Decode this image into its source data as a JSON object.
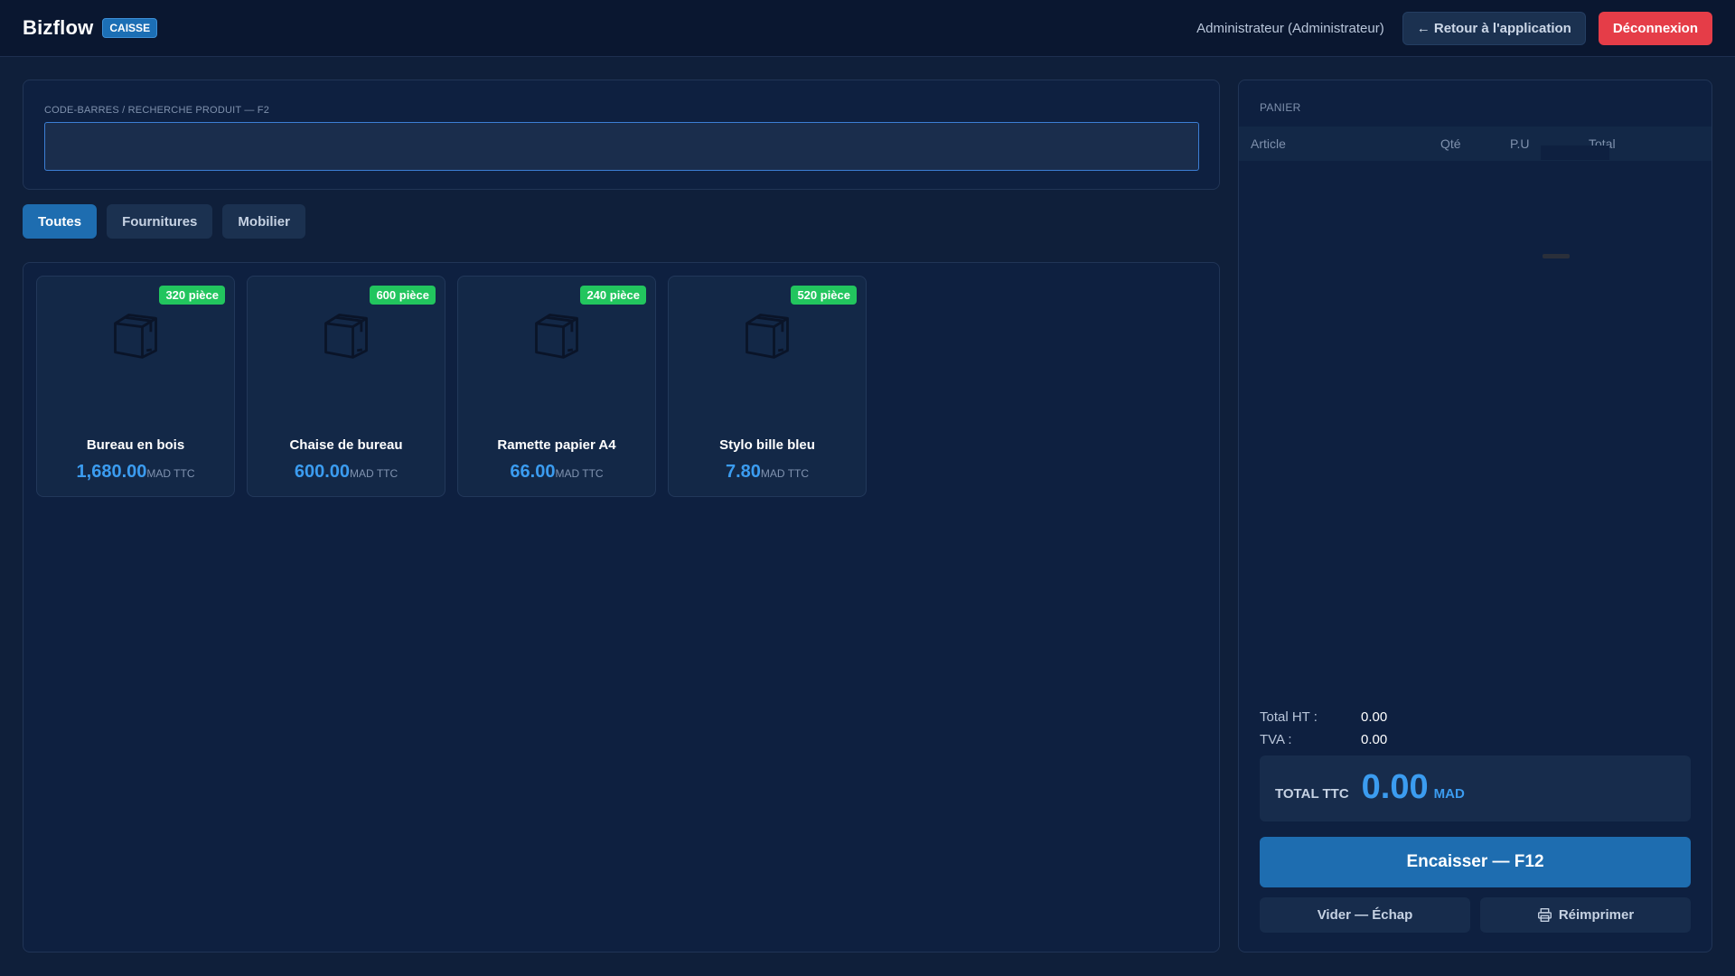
{
  "header": {
    "brand": "Bizflow",
    "badge": "CAISSE",
    "user": "Administrateur (Administrateur)",
    "back_button": "← Retour à l'application",
    "logout_button": "Déconnexion"
  },
  "search": {
    "label": "CODE-BARRES / RECHERCHE PRODUIT — F2",
    "value": "",
    "placeholder": ""
  },
  "tabs": [
    {
      "label": "Toutes",
      "active": true
    },
    {
      "label": "Fournitures",
      "active": false
    },
    {
      "label": "Mobilier",
      "active": false
    }
  ],
  "products": [
    {
      "name": "Bureau en bois",
      "price": "1,680.00",
      "unit": "MAD TTC",
      "stock": "320 pièce",
      "icon": "box-icon"
    },
    {
      "name": "Chaise de bureau",
      "price": "600.00",
      "unit": "MAD TTC",
      "stock": "600 pièce",
      "icon": "box-icon"
    },
    {
      "name": "Ramette papier A4",
      "price": "66.00",
      "unit": "MAD TTC",
      "stock": "240 pièce",
      "icon": "box-icon"
    },
    {
      "name": "Stylo bille bleu",
      "price": "7.80",
      "unit": "MAD TTC",
      "stock": "520 pièce",
      "icon": "box-icon"
    }
  ],
  "cart": {
    "title": "PANIER",
    "columns": {
      "article": "Article",
      "qty": "Qté",
      "pu": "P.U",
      "total": "Total"
    },
    "total_ht_label": "Total HT :",
    "total_ht_value": "0.00",
    "tva_label": "TVA :",
    "tva_value": "0.00",
    "ttc_label": "TOTAL TTC",
    "ttc_value": "0.00",
    "ttc_currency": "MAD",
    "checkout_button": "Encaisser — F12",
    "clear_button": "Vider — Échap",
    "reprint_button": "Réimprimer"
  },
  "colors": {
    "accent": "#1e6db0",
    "price": "#3b9cf0",
    "stock_badge": "#22c55e",
    "danger": "#e53d48",
    "background": "#0f1f3a"
  }
}
